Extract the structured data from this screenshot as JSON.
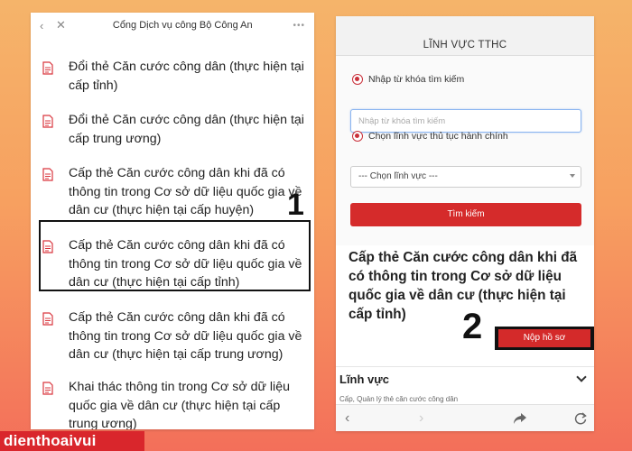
{
  "left_screen": {
    "title": "Cổng Dịch vụ công Bộ Công An",
    "back_icon": "chevron-left-icon",
    "close_icon": "close-icon",
    "more_label": "•••",
    "items": [
      {
        "icon": "pdf-document-icon",
        "text": "Đổi thẻ Căn cước công dân (thực hiện tại cấp tỉnh)"
      },
      {
        "icon": "pdf-document-icon",
        "text": "Đổi thẻ Căn cước công dân (thực hiện tại cấp trung ương)"
      },
      {
        "icon": "pdf-document-icon",
        "text": "Cấp thẻ Căn cước công dân khi đã có thông tin trong Cơ sở dữ liệu quốc gia về dân cư (thực hiện tại cấp huyện)"
      },
      {
        "icon": "pdf-document-icon",
        "text": "Cấp thẻ Căn cước công dân khi đã có thông tin trong Cơ sở dữ liệu quốc gia về dân cư (thực hiện tại cấp tỉnh)"
      },
      {
        "icon": "pdf-document-icon",
        "text": "Cấp thẻ Căn cước công dân khi đã có thông tin trong Cơ sở dữ liệu quốc gia về dân cư (thực hiện tại cấp trung ương)"
      },
      {
        "icon": "pdf-document-icon",
        "text": "Khai thác thông tin trong Cơ sở dữ liệu quốc gia về dân cư (thực hiện tại cấp trung ương)"
      }
    ],
    "step_label": "1"
  },
  "right_screen": {
    "panel_title": "LĨNH VỰC TTHC",
    "radio_keyword_label": "Nhập từ khóa tìm kiếm",
    "search_placeholder": "Nhập từ khóa tìm kiếm",
    "radio_field_label": "Chọn lĩnh vực thủ tục hành chính",
    "select_value": "--- Chọn lĩnh vực ---",
    "search_button": "Tìm kiếm",
    "procedure_title": "Cấp thẻ Căn cước công dân khi đã có thông tin trong Cơ sở dữ liệu quốc gia về dân cư (thực hiện tại cấp tỉnh)",
    "submit_button": "Nộp hồ sơ",
    "step_label": "2",
    "field_label": "Lĩnh vực",
    "field_value": "Cấp, Quản lý thẻ căn cước công dân",
    "accent_color": "#d52b2b"
  },
  "brand": {
    "name": "dienthoaivui",
    "color": "#d9262c"
  }
}
